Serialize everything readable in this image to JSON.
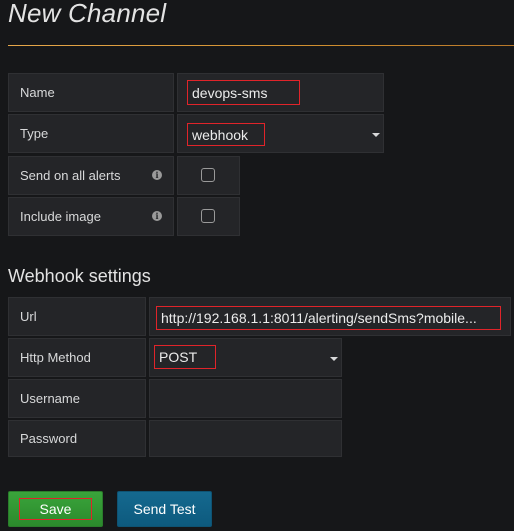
{
  "page": {
    "title": "New Channel"
  },
  "form": {
    "name": {
      "label": "Name",
      "value": "devops-sms"
    },
    "type": {
      "label": "Type",
      "value": "webhook"
    },
    "send_on_all_alerts": {
      "label": "Send on all alerts",
      "checked": false
    },
    "include_image": {
      "label": "Include image",
      "checked": false
    }
  },
  "webhook": {
    "section_title": "Webhook settings",
    "url": {
      "label": "Url",
      "value": "http://192.168.1.1:8011/alerting/sendSms?mobile..."
    },
    "http_method": {
      "label": "Http Method",
      "value": "POST"
    },
    "username": {
      "label": "Username",
      "value": ""
    },
    "password": {
      "label": "Password",
      "value": ""
    }
  },
  "buttons": {
    "save_label": "Save",
    "send_test_label": "Send Test"
  },
  "colors": {
    "background": "#161719",
    "highlight": "#e0242a",
    "save": "#2f9330",
    "send_test": "#12628a",
    "rule": "#e6a74a"
  }
}
